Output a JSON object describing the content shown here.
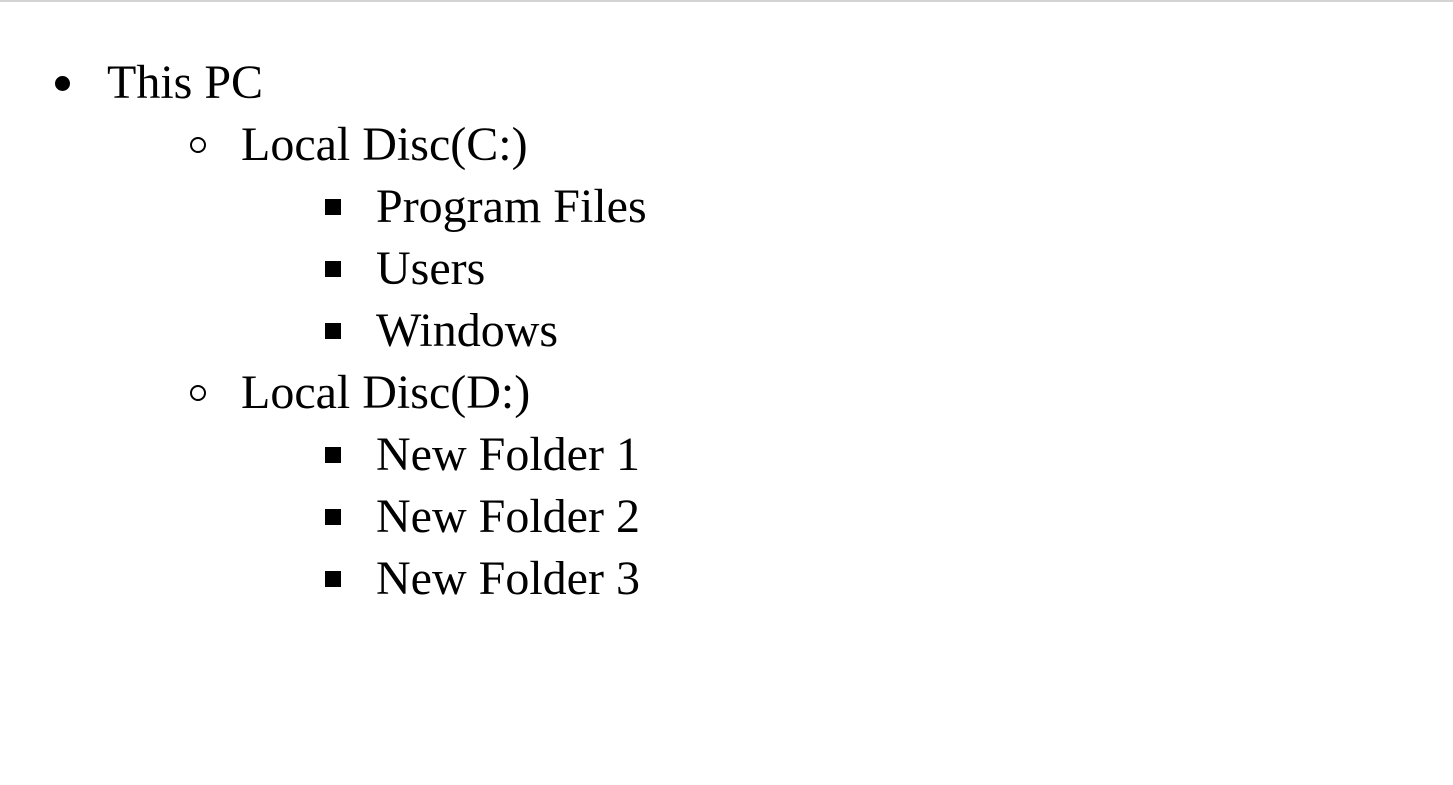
{
  "tree": {
    "root": {
      "label": "This PC",
      "icon": "bullet-disc",
      "children": [
        {
          "label": "Local Disc(C:)",
          "icon": "bullet-circle",
          "children": [
            {
              "label": "Program Files",
              "icon": "bullet-square"
            },
            {
              "label": "Users",
              "icon": "bullet-square"
            },
            {
              "label": "Windows",
              "icon": "bullet-square"
            }
          ]
        },
        {
          "label": "Local Disc(D:)",
          "icon": "bullet-circle",
          "children": [
            {
              "label": "New Folder 1",
              "icon": "bullet-square"
            },
            {
              "label": "New Folder 2",
              "icon": "bullet-square"
            },
            {
              "label": "New Folder 3",
              "icon": "bullet-square"
            }
          ]
        }
      ]
    }
  },
  "colors": {
    "background": "#ffffff",
    "text": "#000000",
    "top_border": "#d4d4d4"
  }
}
